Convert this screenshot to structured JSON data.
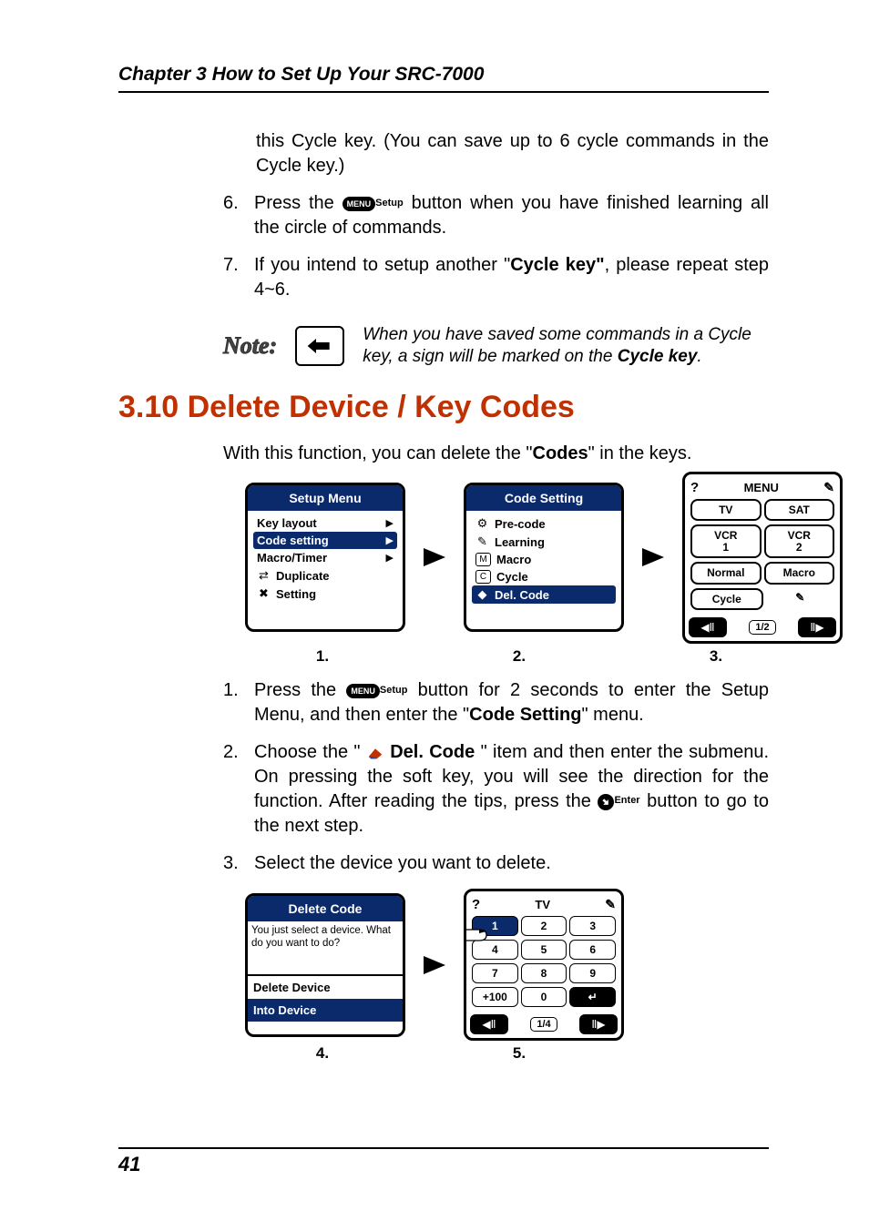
{
  "chapter_header": "Chapter 3  How to Set Up Your SRC-7000",
  "continued_para": "this Cycle key. (You can save up to 6 cycle commands in the Cycle key.)",
  "icons": {
    "setup_pill": "MENU",
    "setup_suffix": "Setup",
    "enter_suffix": "Enter",
    "back_arrow": "back-arrow",
    "right_tri": "▶",
    "eraser": "eraser"
  },
  "list_a": {
    "item6": {
      "num": "6.",
      "pre": "Press the ",
      "post": " button when you have finished learning all the circle of commands."
    },
    "item7": {
      "num": "7.",
      "pre": "If you intend to setup another \"",
      "bold": "Cycle key\"",
      "post": ", please repeat step 4~6."
    }
  },
  "note": {
    "label": "Note:",
    "text_pre": "When you have saved some commands in a Cycle key, a sign will be marked on the ",
    "text_bold": "Cycle key",
    "text_post": "."
  },
  "section_title": "3.10 Delete Device / Key Codes",
  "lead": {
    "pre": "With this function, you can delete the \"",
    "bold": "Codes",
    "post": "\" in the keys."
  },
  "screens1": {
    "s1": {
      "title": "Setup Menu",
      "items": [
        {
          "label": "Key layout",
          "tri": "▶",
          "sel": false
        },
        {
          "label": "Code setting",
          "tri": "▶",
          "sel": true
        },
        {
          "label": "Macro/Timer",
          "tri": "▶",
          "sel": false
        },
        {
          "label": "Duplicate",
          "glyph": "⇄",
          "sel": false
        },
        {
          "label": "Setting",
          "glyph": "✖",
          "sel": false
        }
      ]
    },
    "s2": {
      "title": "Code Setting",
      "items": [
        {
          "label": "Pre-code",
          "glyph": "⚙",
          "sel": false
        },
        {
          "label": "Learning",
          "glyph": "✎",
          "sel": false
        },
        {
          "label": "Macro",
          "glyph": "M",
          "box": true,
          "sel": false
        },
        {
          "label": "Cycle",
          "glyph": "C",
          "box": true,
          "sel": false
        },
        {
          "label": "Del. Code",
          "glyph": "◆",
          "sel": true
        }
      ]
    },
    "s3": {
      "top": {
        "q": "?",
        "title": "MENU",
        "gearish": "✎"
      },
      "devices_row1": [
        {
          "label": "TV"
        },
        {
          "label": "SAT"
        }
      ],
      "devices_row2": [
        {
          "line1": "VCR",
          "line2": "1"
        },
        {
          "line1": "VCR",
          "line2": "2"
        }
      ],
      "devices_row3": [
        {
          "label": "Normal"
        },
        {
          "label": "Macro"
        }
      ],
      "devices_row4": [
        {
          "label": "Cycle"
        },
        {
          "gearish": "✎"
        }
      ],
      "nav": {
        "left": "◀Ⅱ",
        "page": "1/2",
        "right": "Ⅱ▶"
      }
    },
    "captions": [
      "1.",
      "2.",
      "3."
    ]
  },
  "list_b": {
    "item1": {
      "num": "1.",
      "pre": "Press the ",
      "mid": " button for 2 seconds to enter the Setup Menu, and then enter the \"",
      "bold": "Code Setting",
      "post": "\" menu."
    },
    "item2": {
      "num": "2.",
      "pre": "Choose the \"",
      "bold": " Del. Code",
      "mid": "\" item and then enter the submenu. On pressing the soft key, you will see the direction for the function. After reading the tips, press the ",
      "post": " button to go to the next step."
    },
    "item3": {
      "num": "3.",
      "text": "Select the device you want to delete."
    }
  },
  "screens2": {
    "s4": {
      "title": "Delete Code",
      "tip": "You just select a device. What do you want to do?",
      "opts": [
        {
          "label": "Delete Device",
          "sel": false
        },
        {
          "label": "Into Device",
          "sel": true
        }
      ]
    },
    "s5": {
      "top": {
        "q": "?",
        "title": "TV",
        "gearish": "✎"
      },
      "keys_rows": [
        [
          {
            "label": "1",
            "sel": true
          },
          {
            "label": "2"
          },
          {
            "label": "3"
          }
        ],
        [
          {
            "label": "4"
          },
          {
            "label": "5"
          },
          {
            "label": "6"
          }
        ],
        [
          {
            "label": "7"
          },
          {
            "label": "8"
          },
          {
            "label": "9"
          }
        ],
        [
          {
            "label": "+100"
          },
          {
            "label": "0"
          },
          {
            "label": "↵",
            "enter": true
          }
        ]
      ],
      "nav": {
        "left": "◀Ⅱ",
        "page": "1/4",
        "right": "Ⅱ▶"
      },
      "hand": true
    },
    "captions": [
      "4.",
      "5."
    ]
  },
  "page_number": "41"
}
